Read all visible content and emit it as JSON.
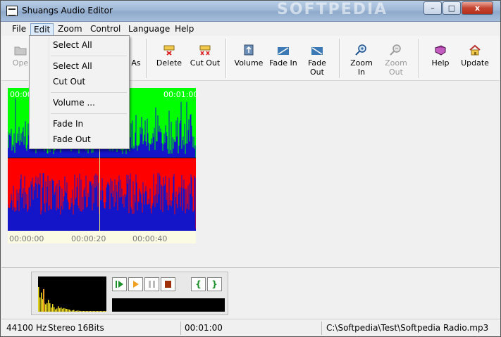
{
  "window": {
    "title": "Shuangs Audio Editor",
    "watermark": "SOFTPEDIA"
  },
  "caption_buttons": {
    "minimize": "–",
    "maximize": "□",
    "close": "x"
  },
  "menubar": {
    "file": "File",
    "edit": "Edit",
    "zoom": "Zoom",
    "control": "Control",
    "language": "Language",
    "help": "Help"
  },
  "toolbar": {
    "open": "Ope",
    "save_as": "As",
    "delete": "Delete",
    "cut_out": "Cut Out",
    "volume": "Volume",
    "fade_in": "Fade In",
    "fade_out": "Fade Out",
    "zoom_in": "Zoom In",
    "zoom_out": "Zoom Out",
    "help": "Help",
    "update": "Update"
  },
  "edit_menu": {
    "header": "Select All",
    "select_all": "Select All",
    "cut_out": "Cut Out",
    "volume": "Volume ...",
    "fade_in": "Fade In",
    "fade_out": "Fade Out"
  },
  "waveform": {
    "time_start": "00:00:00",
    "time_end": "00:01:00"
  },
  "timeline": {
    "t0": "00:00:00",
    "t20": "00:00:20",
    "t40": "00:00:40"
  },
  "player": {
    "play": "▶",
    "play_from": "▶",
    "pause": "❚❚",
    "stop": "■",
    "mark_in": "{",
    "mark_out": "}"
  },
  "status": {
    "sample_rate": "44100 Hz",
    "channels": "Stereo",
    "bits": "16Bits",
    "duration": "00:01:00",
    "file_path": "C:\\Softpedia\\Test\\Softpedia Radio.mp3"
  },
  "colors": {
    "wave_top": "#00ff00",
    "wave_bottom": "#ff0000",
    "wave_signal": "#1414c8"
  }
}
